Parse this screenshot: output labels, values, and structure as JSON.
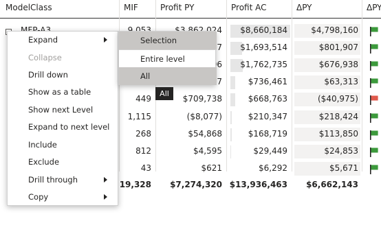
{
  "table": {
    "columns": [
      "ModelClass",
      "MIF",
      "Profit PY",
      "Profit AC",
      "ΔPY",
      "ΔPY"
    ],
    "first_row_label": "MFP-A3",
    "rows": [
      {
        "mif": "9,053",
        "profit_py": "$3,862,024",
        "profit_ac": "$8,660,184",
        "dpy": "$4,798,160",
        "flag": "green",
        "bar": 0.62
      },
      {
        "mif": "",
        "profit_py": "…07",
        "profit_ac": "$1,693,514",
        "dpy": "$801,907",
        "flag": "green",
        "bar": 0.12
      },
      {
        "mif": "",
        "profit_py": "…96",
        "profit_ac": "$1,762,735",
        "dpy": "$676,938",
        "flag": "green",
        "bar": 0.13
      },
      {
        "mif": "",
        "profit_py": "…47",
        "profit_ac": "$736,461",
        "dpy": "$63,313",
        "flag": "green",
        "bar": 0.05
      },
      {
        "mif": "449",
        "profit_py": "$709,738",
        "profit_ac": "$668,763",
        "dpy": "($40,975)",
        "flag": "red",
        "bar": 0.05
      },
      {
        "mif": "1,115",
        "profit_py": "($8,077)",
        "profit_ac": "$210,347",
        "dpy": "$218,424",
        "flag": "green",
        "bar": 0.015
      },
      {
        "mif": "268",
        "profit_py": "$54,868",
        "profit_ac": "$168,719",
        "dpy": "$113,850",
        "flag": "green",
        "bar": 0.012
      },
      {
        "mif": "812",
        "profit_py": "$4,595",
        "profit_ac": "$29,449",
        "dpy": "$24,853",
        "flag": "green",
        "bar": 0.002
      },
      {
        "mif": "43",
        "profit_py": "$621",
        "profit_ac": "$6,292",
        "dpy": "$5,671",
        "flag": "green",
        "bar": 0.0
      }
    ],
    "total": {
      "mif": "19,328",
      "profit_py": "$7,274,320",
      "profit_ac": "$13,936,463",
      "dpy": "$6,662,143"
    }
  },
  "context_menu": {
    "items": [
      {
        "label": "Expand",
        "submenu": true,
        "disabled": false
      },
      {
        "label": "Collapse",
        "submenu": false,
        "disabled": true
      },
      {
        "label": "Drill down",
        "submenu": false,
        "disabled": false
      },
      {
        "label": "Show as a table",
        "submenu": false,
        "disabled": false
      },
      {
        "label": "Show next Level",
        "submenu": false,
        "disabled": false
      },
      {
        "label": "Expand to next level",
        "submenu": false,
        "disabled": false
      },
      {
        "label": "Include",
        "submenu": false,
        "disabled": false
      },
      {
        "label": "Exclude",
        "submenu": false,
        "disabled": false
      },
      {
        "label": "Drill through",
        "submenu": true,
        "disabled": false
      },
      {
        "label": "Copy",
        "submenu": true,
        "disabled": false
      }
    ]
  },
  "submenu": {
    "items": [
      "Selection",
      "Entire level",
      "All"
    ]
  },
  "tooltip": "All",
  "colors": {
    "flag_green": "#3c9a3c",
    "flag_red": "#e05a4c",
    "bar": "#e6e6e6"
  }
}
